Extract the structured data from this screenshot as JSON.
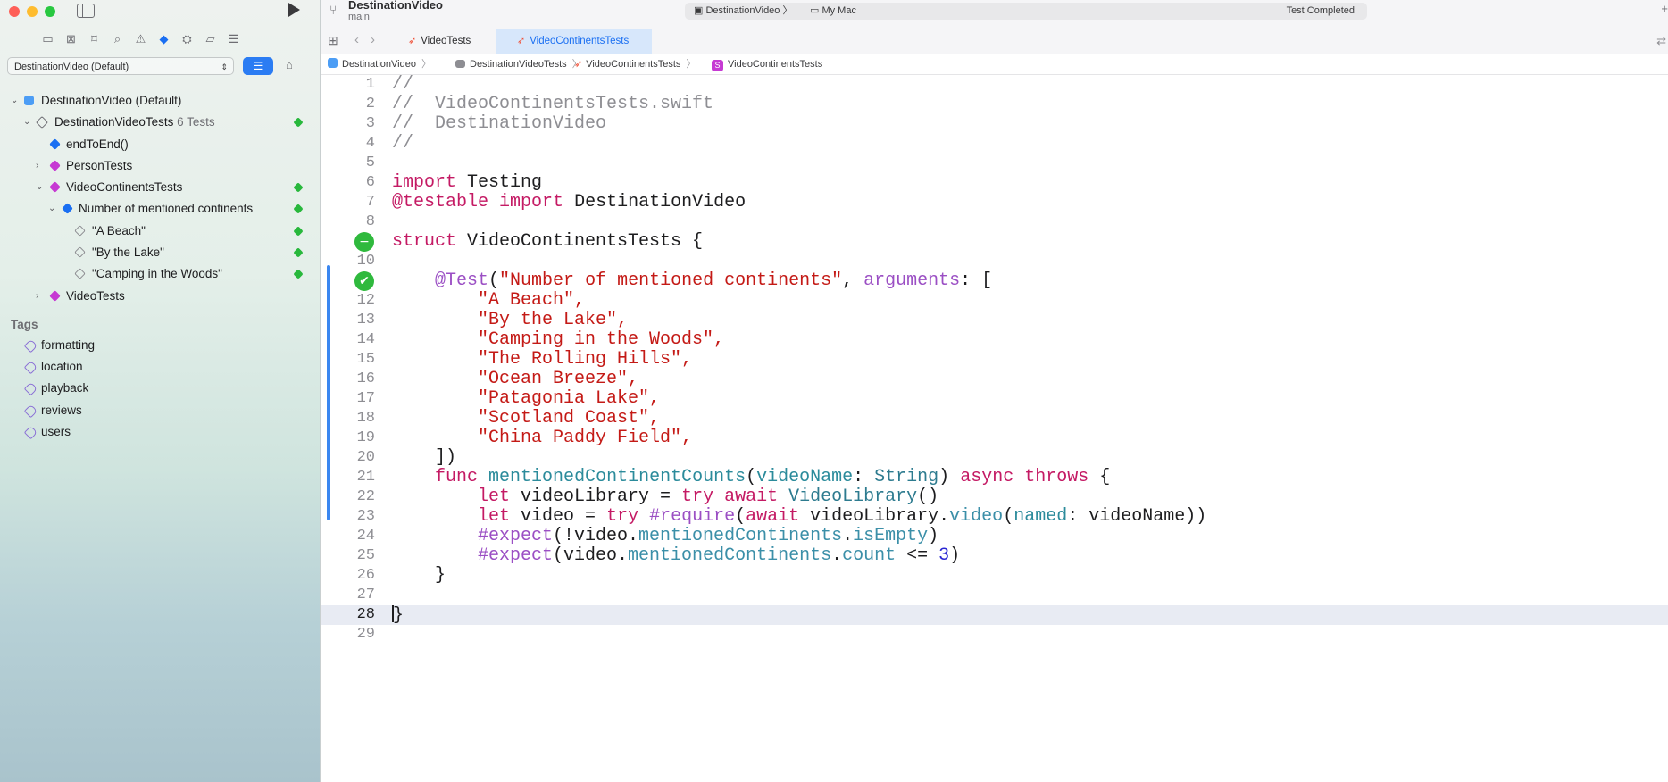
{
  "window": {
    "project_title": "DestinationVideo",
    "branch": "main"
  },
  "activity_bar": {
    "project": "DestinationVideo",
    "destination": "My Mac",
    "status": "Test Completed"
  },
  "sidebar": {
    "scheme_filter": "DestinationVideo (Default)",
    "tree": [
      {
        "label": "DestinationVideo (Default)",
        "count": "",
        "passed": false
      },
      {
        "label": "DestinationVideoTests",
        "count": "6 Tests",
        "passed": true
      },
      {
        "label": "endToEnd()",
        "count": "",
        "passed": false
      },
      {
        "label": "PersonTests",
        "count": "",
        "passed": false
      },
      {
        "label": "VideoContinentsTests",
        "count": "",
        "passed": true
      },
      {
        "label": "Number of mentioned continents",
        "count": "",
        "passed": true
      },
      {
        "label": "\"A Beach\"",
        "count": "",
        "passed": true
      },
      {
        "label": "\"By the Lake\"",
        "count": "",
        "passed": true
      },
      {
        "label": "\"Camping in the Woods\"",
        "count": "",
        "passed": true
      },
      {
        "label": "VideoTests",
        "count": "",
        "passed": false
      }
    ],
    "tags_title": "Tags",
    "tags": [
      "formatting",
      "location",
      "playback",
      "reviews",
      "users"
    ]
  },
  "tabs": [
    {
      "label": "VideoTests",
      "active": false
    },
    {
      "label": "VideoContinentsTests",
      "active": true
    }
  ],
  "jump_bar": [
    "DestinationVideo",
    "DestinationVideoTests",
    "VideoContinentsTests",
    "VideoContinentsTests"
  ],
  "editor": {
    "current_line": 28,
    "line_numbers": [
      "1",
      "2",
      "3",
      "4",
      "5",
      "6",
      "7",
      "8",
      "9",
      "10",
      "11",
      "12",
      "13",
      "14",
      "15",
      "16",
      "17",
      "18",
      "19",
      "20",
      "21",
      "22",
      "23",
      "24",
      "25",
      "26",
      "27",
      "28",
      "29"
    ],
    "lines": [
      "//",
      "//  VideoContinentsTests.swift",
      "//  DestinationVideo",
      "//",
      "",
      "import Testing",
      "@testable import DestinationVideo",
      "",
      "struct VideoContinentsTests {",
      "",
      "    @Test(\"Number of mentioned continents\", arguments: [",
      "        \"A Beach\",",
      "        \"By the Lake\",",
      "        \"Camping in the Woods\",",
      "        \"The Rolling Hills\",",
      "        \"Ocean Breeze\",",
      "        \"Patagonia Lake\",",
      "        \"Scotland Coast\",",
      "        \"China Paddy Field\",",
      "    ])",
      "    func mentionedContinentCounts(videoName: String) async throws {",
      "        let videoLibrary = try await VideoLibrary()",
      "        let video = try #require(await videoLibrary.video(named: videoName))",
      "        #expect(!video.mentionedContinents.isEmpty)",
      "        #expect(video.mentionedContinents.count <= 3)",
      "    }",
      "",
      "}",
      ""
    ]
  },
  "colors": {
    "accent": "#1a6ff2",
    "pass_green": "#2fb93d",
    "keyword": "#c41a64",
    "string": "#c41a16"
  }
}
